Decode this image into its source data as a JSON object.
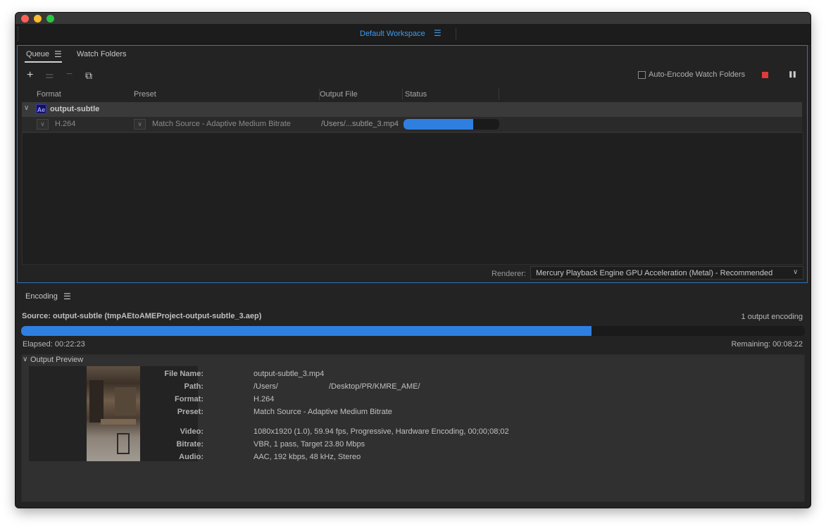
{
  "workspace": {
    "label": "Default Workspace",
    "menu_icon": "hamburger-icon"
  },
  "queue": {
    "tabs": [
      {
        "label": "Queue",
        "active": true
      },
      {
        "label": "Watch Folders",
        "active": false
      }
    ],
    "toolbar": {
      "add_icon": "+",
      "settings_icon": "⚌",
      "remove_icon": "−",
      "duplicate_icon": "⧉",
      "auto_encode_label": "Auto-Encode Watch Folders",
      "auto_encode_checked": false,
      "stop_color": "#e03a3a",
      "pause_icon": "❚❚"
    },
    "columns": {
      "format": "Format",
      "preset": "Preset",
      "output": "Output File",
      "status": "Status"
    },
    "group": {
      "badge": "Ae",
      "name": "output-subtle"
    },
    "item": {
      "format": "H.264",
      "preset": "Match Source - Adaptive Medium Bitrate",
      "output": "/Users/...subtle_3.mp4",
      "progress": 0.73
    },
    "renderer": {
      "label": "Renderer:",
      "value": "Mercury Playback Engine GPU Acceleration (Metal) - Recommended"
    }
  },
  "encoding": {
    "title": "Encoding",
    "source": "Source: output-subtle (tmpAEtoAMEProject-output-subtle_3.aep)",
    "output_count": "1 output encoding",
    "progress": 0.728,
    "elapsed": "Elapsed: 00:22:23",
    "remaining": "Remaining: 00:08:22",
    "preview_title": "Output Preview",
    "details": {
      "file_name_label": "File Name:",
      "file_name": "output-subtle_3.mp4",
      "path_label": "Path:",
      "path_a": "/Users/",
      "path_b": "/Desktop/PR/KMRE_AME/",
      "format_label": "Format:",
      "format": "H.264",
      "preset_label": "Preset:",
      "preset": "Match Source - Adaptive Medium Bitrate",
      "video_label": "Video:",
      "video": "1080x1920 (1.0), 59.94 fps, Progressive, Hardware Encoding, 00;00;08;02",
      "bitrate_label": "Bitrate:",
      "bitrate": "VBR, 1 pass, Target 23.80 Mbps",
      "audio_label": "Audio:",
      "audio": "AAC, 192 kbps, 48 kHz, Stereo"
    }
  },
  "colors": {
    "accent": "#2f7fe0",
    "panel_focus": "#2e73c0"
  }
}
